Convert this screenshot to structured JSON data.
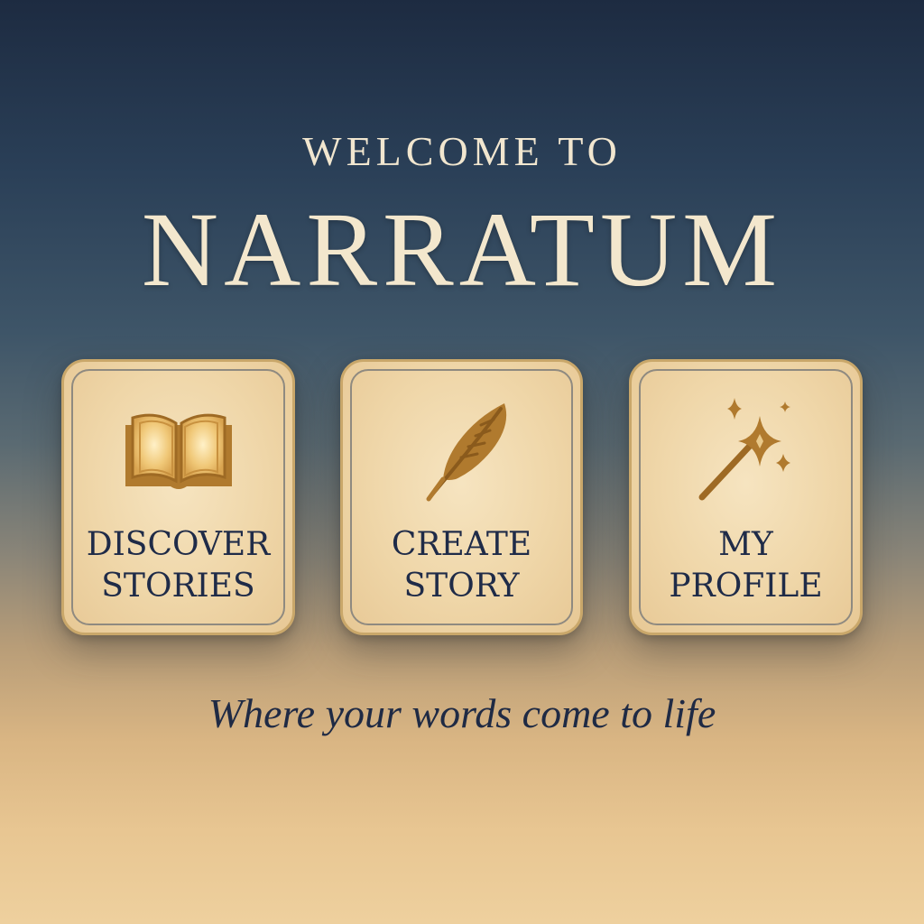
{
  "header": {
    "welcome": "WELCOME TO",
    "brand": "NARRATUM"
  },
  "cards": [
    {
      "label": "DISCOVER\nSTORIES",
      "icon": "open-book-icon"
    },
    {
      "label": "CREATE\nSTORY",
      "icon": "quill-feather-icon"
    },
    {
      "label": "MY\nPROFILE",
      "icon": "magic-wand-icon"
    }
  ],
  "tagline": "Where your words come to life",
  "colors": {
    "accent_gold": "#b07a2e",
    "card_bg": "#f2dcb2",
    "text_dark": "#1f2b48",
    "title_cream": "#f3e7cd",
    "bg_top": "#1d2b41",
    "bg_bottom": "#eed09e"
  }
}
